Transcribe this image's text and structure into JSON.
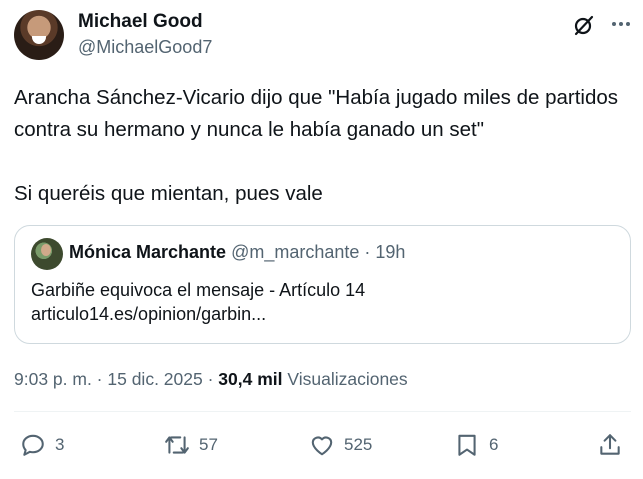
{
  "author": {
    "name": "Michael Good",
    "handle": "@MichaelGood7"
  },
  "tweet": {
    "paragraph1": "Arancha Sánchez-Vicario dijo que \"Había jugado miles de partidos contra su hermano y nunca le había ganado un set\"",
    "paragraph2": "Si queréis que mientan, pues vale"
  },
  "quote": {
    "name": "Mónica Marchante",
    "handle_time": "@m_marchante · 19h",
    "line1": "Garbiñe equivoca el mensaje - Artículo 14",
    "line2": "articulo14.es/opinion/garbin..."
  },
  "meta": {
    "time_date": "9:03 p. m. · 15 dic. 2025 · ",
    "views_count": "30,4 mil",
    "views_label": " Visualizaciones"
  },
  "actions": {
    "replies": "3",
    "retweets": "57",
    "likes": "525",
    "bookmarks": "6"
  },
  "icons": [
    "grok-icon",
    "more-icon",
    "reply-icon",
    "retweet-icon",
    "like-icon",
    "bookmark-icon",
    "share-icon"
  ],
  "colors": {
    "text": "#0f1419",
    "secondary": "#536471",
    "border": "#cfd9de"
  }
}
